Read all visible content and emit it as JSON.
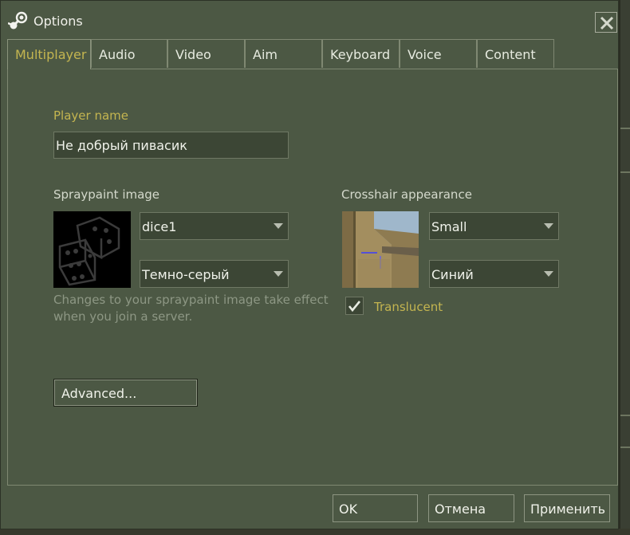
{
  "window": {
    "title": "Options",
    "close_icon": "close-icon"
  },
  "tabs": [
    {
      "label": "Multiplayer",
      "active": true
    },
    {
      "label": "Audio"
    },
    {
      "label": "Video"
    },
    {
      "label": "Aim"
    },
    {
      "label": "Keyboard"
    },
    {
      "label": "Voice"
    },
    {
      "label": "Content"
    }
  ],
  "multiplayer": {
    "player_name_label": "Player name",
    "player_name_value": "Не добрый пивасик",
    "spray_label": "Spraypaint image",
    "spray_image": "dice1",
    "spray_color": "Темно-серый",
    "spray_hint_line1": "Changes to your spraypaint image take effect",
    "spray_hint_line2": "when you join a server.",
    "crosshair_label": "Crosshair appearance",
    "crosshair_size": "Small",
    "crosshair_color": "Синий",
    "translucent_label": "Translucent",
    "translucent_checked": true,
    "advanced_label": "Advanced..."
  },
  "footer": {
    "ok": "OK",
    "cancel": "Отмена",
    "apply": "Применить"
  },
  "colors": {
    "accent_gold": "#c4b550",
    "window_bg": "#4c5844",
    "field_bg": "#3c4635"
  }
}
